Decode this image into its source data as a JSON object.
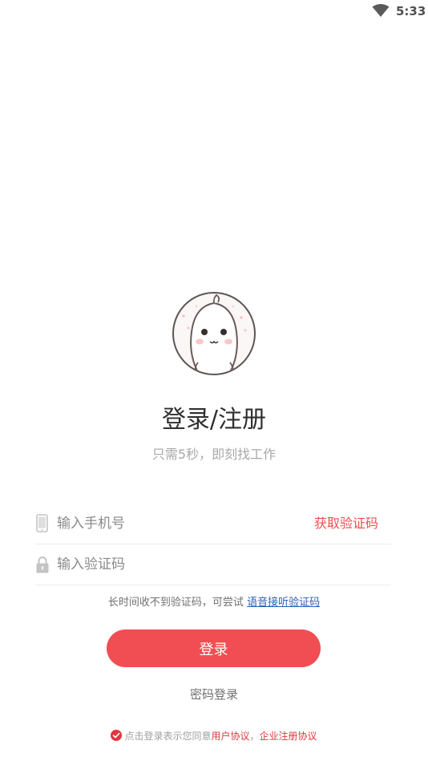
{
  "status_bar": {
    "time": "5:33",
    "wifi_icon": "wifi-icon"
  },
  "avatar": {
    "icon": "cartoon-bun-avatar"
  },
  "title": "登录/注册",
  "subtitle": "只需5秒，即刻找工作",
  "phone": {
    "placeholder": "输入手机号",
    "value": "",
    "icon": "phone-icon"
  },
  "get_code_label": "获取验证码",
  "code": {
    "placeholder": "输入验证码",
    "value": "",
    "icon": "lock-icon"
  },
  "voice_hint": {
    "prefix": "长时间收不到验证码，可尝试 ",
    "link": "语音接听验证码"
  },
  "login_button": "登录",
  "password_login": "密码登录",
  "agreement": {
    "checked": true,
    "prefix": "点击登录表示您同意",
    "user_agreement": "用户协议",
    "separator": "，",
    "enterprise_agreement": "企业注册协议"
  },
  "colors": {
    "accent": "#f04e52",
    "link_red": "#e3363b",
    "link_blue": "#2a5fb8"
  }
}
